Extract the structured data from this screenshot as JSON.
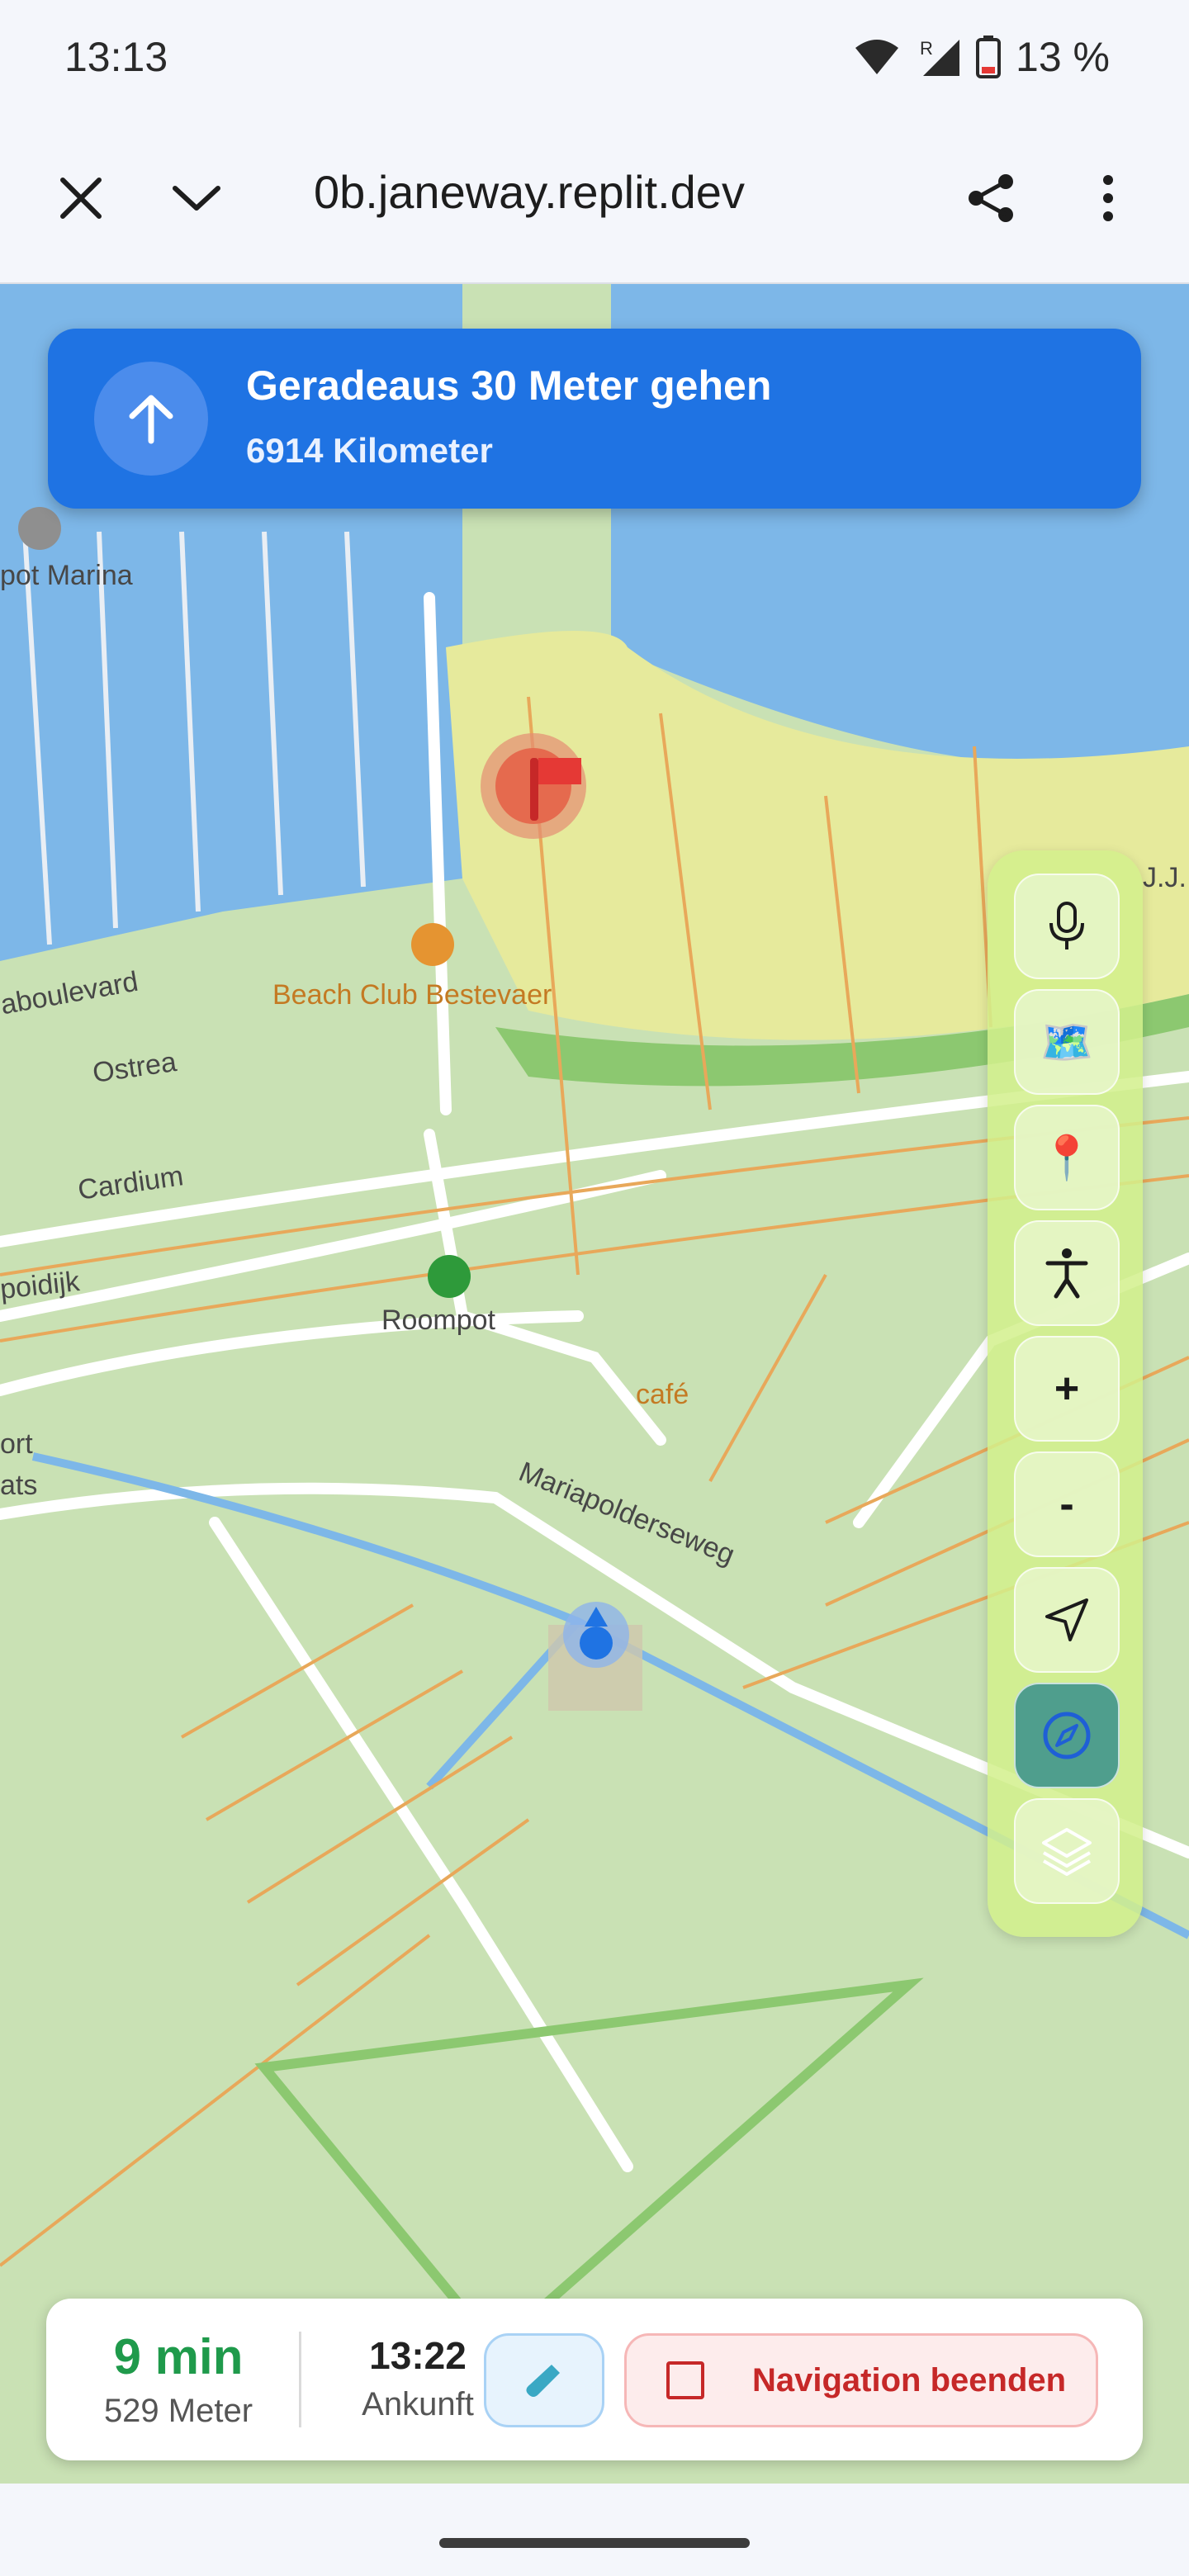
{
  "status_bar": {
    "time": "13:13",
    "battery": "13 %",
    "icons": [
      "wifi-icon",
      "signal-roaming-icon",
      "battery-low-icon"
    ]
  },
  "browser": {
    "url": "0b.janeway.replit.dev",
    "icons": [
      "close-icon",
      "chevron-down-icon",
      "share-icon",
      "more-vert-icon"
    ]
  },
  "navigation": {
    "instruction": "Geradeaus 30 Meter gehen",
    "distance": "6914 Kilometer",
    "arrow_icon": "arrow-up-icon"
  },
  "map": {
    "labels": {
      "marina": "pot Marina",
      "beach_club": "Beach Club Bestevaer",
      "boulevard": "aboulevard",
      "ostrea": "Ostrea",
      "cardium": "Cardium",
      "poidijk": "poidijk",
      "roompot": "Roompot",
      "cafe": "café",
      "mariapolderseweg": "Mariapolderseweg",
      "ort": "ort",
      "ats": "ats",
      "jv": "J.J. v"
    },
    "colors": {
      "water": "#7db7e8",
      "land": "#c9e1b4",
      "beach": "#e6ea9c",
      "road_orange": "#e8a85a"
    }
  },
  "controls": [
    {
      "name": "microphone-icon",
      "symbol": "🎤"
    },
    {
      "name": "map-icon",
      "symbol": "🗺️"
    },
    {
      "name": "pin-icon",
      "symbol": "📍"
    },
    {
      "name": "accessibility-icon",
      "symbol": "🚶"
    },
    {
      "name": "zoom-in-button",
      "symbol": "+"
    },
    {
      "name": "zoom-out-button",
      "symbol": "-"
    },
    {
      "name": "locate-icon",
      "symbol": "➤"
    },
    {
      "name": "compass-icon",
      "symbol": "🧭"
    },
    {
      "name": "layers-icon",
      "symbol": "≋"
    }
  ],
  "bottom": {
    "remaining_time": "9 min",
    "remaining_distance": "529 Meter",
    "arrival_time": "13:22",
    "arrival_label": "Ankunft",
    "end_label": "Navigation beenden",
    "test_icon": "test-tube-icon"
  }
}
